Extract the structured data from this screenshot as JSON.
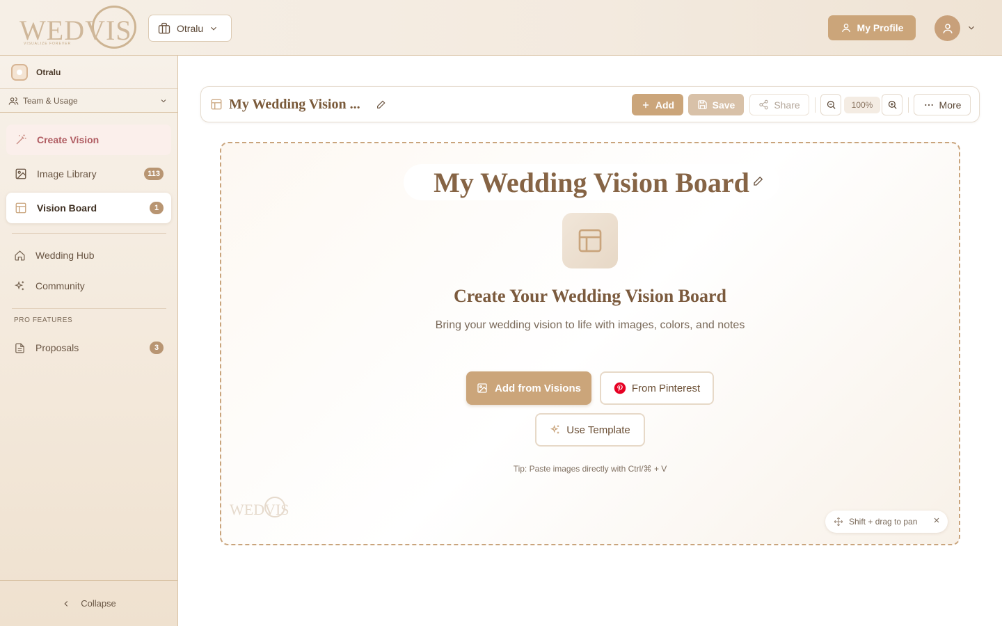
{
  "colors": {
    "accent": "#cba57a",
    "accent_dark": "#866445",
    "active_pink": "#b05c62",
    "badge": "#b89572"
  },
  "header": {
    "logo_text": "WEDVIS",
    "logo_tagline": "VISUALIZE FOREVER",
    "workspace_selector": {
      "label": "Otralu",
      "icon": "briefcase-icon"
    },
    "profile_button": "My Profile",
    "avatar_icon": "user-icon"
  },
  "sidebar": {
    "workspace_name": "Otralu",
    "team_usage": "Team & Usage",
    "primary_items": [
      {
        "label": "Create Vision",
        "icon": "magic-wand-icon",
        "state": "highlight"
      },
      {
        "label": "Image Library",
        "icon": "image-icon",
        "badge": "113"
      },
      {
        "label": "Vision Board",
        "icon": "layout-icon",
        "badge": "1",
        "state": "active"
      }
    ],
    "secondary_items": [
      {
        "label": "Wedding Hub",
        "icon": "home-icon"
      },
      {
        "label": "Community",
        "icon": "sparkles-icon"
      }
    ],
    "pro_section_label": "PRO FEATURES",
    "pro_items": [
      {
        "label": "Proposals",
        "icon": "document-icon",
        "badge": "3"
      }
    ],
    "collapse_label": "Collapse"
  },
  "toolbar": {
    "title": "My Wedding Vision ...",
    "add_label": "Add",
    "save_label": "Save",
    "share_label": "Share",
    "zoom": "100%",
    "more_label": "More"
  },
  "canvas": {
    "board_title": "My Wedding Vision Board",
    "heading": "Create Your Wedding Vision Board",
    "description": "Bring your wedding vision to life with images, colors, and notes",
    "add_from_visions": "Add from Visions",
    "from_pinterest": "From Pinterest",
    "use_template": "Use Template",
    "tip": "Tip: Paste images directly with Ctrl/⌘ + V",
    "watermark": "WEDVIS",
    "pan_hint": "Shift + drag to pan"
  }
}
